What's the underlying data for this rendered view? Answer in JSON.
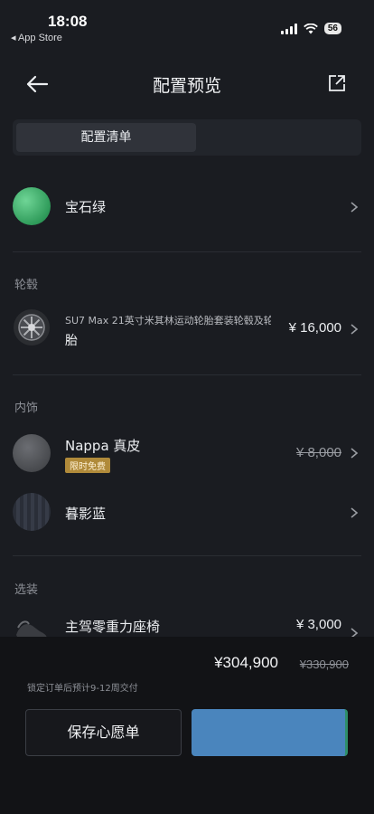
{
  "status_bar": {
    "time": "18:08",
    "back_label": "◂ App Store",
    "battery": "56"
  },
  "header": {
    "title": "配置预览"
  },
  "tabs": [
    {
      "label": "配置清单"
    }
  ],
  "color": {
    "name": "宝石绿"
  },
  "wheels": {
    "section_label": "轮毂",
    "name_line1": "SU7 Max 21英寸米其林运动轮胎套装轮毂及轮胎",
    "name_line2": "胎",
    "price": "¥ 16,000"
  },
  "interior": {
    "section_label": "内饰",
    "material": {
      "name": "Nappa 真皮",
      "badge": "限时免费",
      "price": "¥ 8,000"
    },
    "color": {
      "name": "暮影蓝"
    }
  },
  "options": {
    "section_label": "选装",
    "item": {
      "name": "主驾零重力座椅",
      "price": "¥ 3,000"
    }
  },
  "footer": {
    "total_price": "¥304,900",
    "original_price": "¥330,900",
    "delivery_note": "锁定订单后预计9-12周交付",
    "save_button": "保存心愿单",
    "primary_button": ""
  },
  "colors": {
    "accent": "#4a85bd",
    "swatch_green": "#3fb46e",
    "badge": "#b08a3a"
  }
}
